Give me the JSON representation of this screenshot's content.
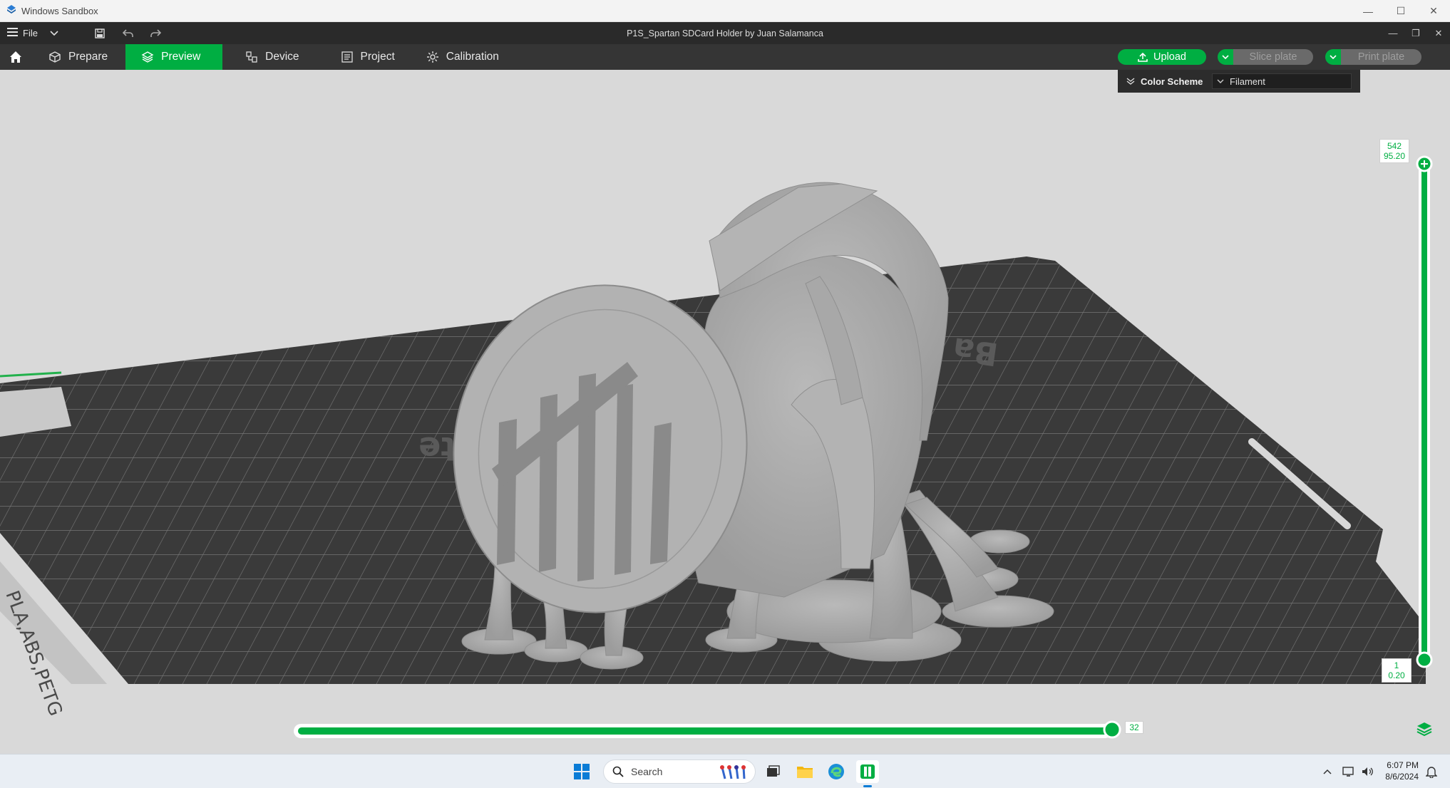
{
  "sandbox": {
    "title": "Windows Sandbox"
  },
  "app": {
    "menu_label": "File",
    "doc_title": "P1S_Spartan SDCard Holder by Juan Salamanca"
  },
  "tabs": [
    {
      "label": "Prepare",
      "icon": "cube-icon"
    },
    {
      "label": "Preview",
      "icon": "layers-icon"
    },
    {
      "label": "Device",
      "icon": "device-icon"
    },
    {
      "label": "Project",
      "icon": "project-icon"
    },
    {
      "label": "Calibration",
      "icon": "calibration-icon"
    }
  ],
  "actions": {
    "upload": "Upload",
    "slice": "Slice plate",
    "print": "Print plate"
  },
  "color_scheme": {
    "label": "Color Scheme",
    "value": "Filament"
  },
  "plate": {
    "label": "plate",
    "label2": "Ba",
    "edge_text": "PLA,ABS,PETG"
  },
  "layers": {
    "top_index": "542",
    "top_height": "95.20",
    "bottom_index": "1",
    "bottom_height": "0.20",
    "move_value": "32"
  },
  "taskbar": {
    "search_placeholder": "Search",
    "time": "6:07 PM",
    "date": "8/6/2024"
  },
  "colors": {
    "accent": "#00ae42",
    "toolbar": "#353535",
    "viewport_bg": "#d9d9d9",
    "plate": "#3a3a3a"
  }
}
